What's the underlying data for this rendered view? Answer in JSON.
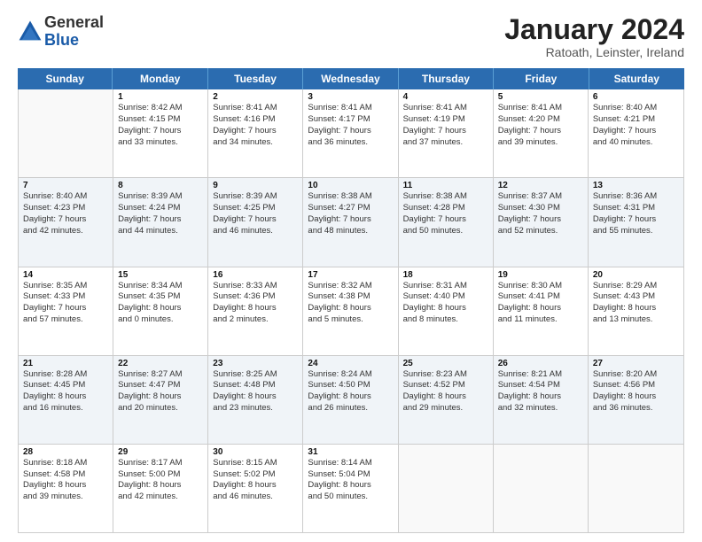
{
  "header": {
    "logo_general": "General",
    "logo_blue": "Blue",
    "month_title": "January 2024",
    "subtitle": "Ratoath, Leinster, Ireland"
  },
  "days_of_week": [
    "Sunday",
    "Monday",
    "Tuesday",
    "Wednesday",
    "Thursday",
    "Friday",
    "Saturday"
  ],
  "weeks": [
    {
      "alt": false,
      "cells": [
        {
          "day": "",
          "lines": []
        },
        {
          "day": "1",
          "lines": [
            "Sunrise: 8:42 AM",
            "Sunset: 4:15 PM",
            "Daylight: 7 hours",
            "and 33 minutes."
          ]
        },
        {
          "day": "2",
          "lines": [
            "Sunrise: 8:41 AM",
            "Sunset: 4:16 PM",
            "Daylight: 7 hours",
            "and 34 minutes."
          ]
        },
        {
          "day": "3",
          "lines": [
            "Sunrise: 8:41 AM",
            "Sunset: 4:17 PM",
            "Daylight: 7 hours",
            "and 36 minutes."
          ]
        },
        {
          "day": "4",
          "lines": [
            "Sunrise: 8:41 AM",
            "Sunset: 4:19 PM",
            "Daylight: 7 hours",
            "and 37 minutes."
          ]
        },
        {
          "day": "5",
          "lines": [
            "Sunrise: 8:41 AM",
            "Sunset: 4:20 PM",
            "Daylight: 7 hours",
            "and 39 minutes."
          ]
        },
        {
          "day": "6",
          "lines": [
            "Sunrise: 8:40 AM",
            "Sunset: 4:21 PM",
            "Daylight: 7 hours",
            "and 40 minutes."
          ]
        }
      ]
    },
    {
      "alt": true,
      "cells": [
        {
          "day": "7",
          "lines": [
            "Sunrise: 8:40 AM",
            "Sunset: 4:23 PM",
            "Daylight: 7 hours",
            "and 42 minutes."
          ]
        },
        {
          "day": "8",
          "lines": [
            "Sunrise: 8:39 AM",
            "Sunset: 4:24 PM",
            "Daylight: 7 hours",
            "and 44 minutes."
          ]
        },
        {
          "day": "9",
          "lines": [
            "Sunrise: 8:39 AM",
            "Sunset: 4:25 PM",
            "Daylight: 7 hours",
            "and 46 minutes."
          ]
        },
        {
          "day": "10",
          "lines": [
            "Sunrise: 8:38 AM",
            "Sunset: 4:27 PM",
            "Daylight: 7 hours",
            "and 48 minutes."
          ]
        },
        {
          "day": "11",
          "lines": [
            "Sunrise: 8:38 AM",
            "Sunset: 4:28 PM",
            "Daylight: 7 hours",
            "and 50 minutes."
          ]
        },
        {
          "day": "12",
          "lines": [
            "Sunrise: 8:37 AM",
            "Sunset: 4:30 PM",
            "Daylight: 7 hours",
            "and 52 minutes."
          ]
        },
        {
          "day": "13",
          "lines": [
            "Sunrise: 8:36 AM",
            "Sunset: 4:31 PM",
            "Daylight: 7 hours",
            "and 55 minutes."
          ]
        }
      ]
    },
    {
      "alt": false,
      "cells": [
        {
          "day": "14",
          "lines": [
            "Sunrise: 8:35 AM",
            "Sunset: 4:33 PM",
            "Daylight: 7 hours",
            "and 57 minutes."
          ]
        },
        {
          "day": "15",
          "lines": [
            "Sunrise: 8:34 AM",
            "Sunset: 4:35 PM",
            "Daylight: 8 hours",
            "and 0 minutes."
          ]
        },
        {
          "day": "16",
          "lines": [
            "Sunrise: 8:33 AM",
            "Sunset: 4:36 PM",
            "Daylight: 8 hours",
            "and 2 minutes."
          ]
        },
        {
          "day": "17",
          "lines": [
            "Sunrise: 8:32 AM",
            "Sunset: 4:38 PM",
            "Daylight: 8 hours",
            "and 5 minutes."
          ]
        },
        {
          "day": "18",
          "lines": [
            "Sunrise: 8:31 AM",
            "Sunset: 4:40 PM",
            "Daylight: 8 hours",
            "and 8 minutes."
          ]
        },
        {
          "day": "19",
          "lines": [
            "Sunrise: 8:30 AM",
            "Sunset: 4:41 PM",
            "Daylight: 8 hours",
            "and 11 minutes."
          ]
        },
        {
          "day": "20",
          "lines": [
            "Sunrise: 8:29 AM",
            "Sunset: 4:43 PM",
            "Daylight: 8 hours",
            "and 13 minutes."
          ]
        }
      ]
    },
    {
      "alt": true,
      "cells": [
        {
          "day": "21",
          "lines": [
            "Sunrise: 8:28 AM",
            "Sunset: 4:45 PM",
            "Daylight: 8 hours",
            "and 16 minutes."
          ]
        },
        {
          "day": "22",
          "lines": [
            "Sunrise: 8:27 AM",
            "Sunset: 4:47 PM",
            "Daylight: 8 hours",
            "and 20 minutes."
          ]
        },
        {
          "day": "23",
          "lines": [
            "Sunrise: 8:25 AM",
            "Sunset: 4:48 PM",
            "Daylight: 8 hours",
            "and 23 minutes."
          ]
        },
        {
          "day": "24",
          "lines": [
            "Sunrise: 8:24 AM",
            "Sunset: 4:50 PM",
            "Daylight: 8 hours",
            "and 26 minutes."
          ]
        },
        {
          "day": "25",
          "lines": [
            "Sunrise: 8:23 AM",
            "Sunset: 4:52 PM",
            "Daylight: 8 hours",
            "and 29 minutes."
          ]
        },
        {
          "day": "26",
          "lines": [
            "Sunrise: 8:21 AM",
            "Sunset: 4:54 PM",
            "Daylight: 8 hours",
            "and 32 minutes."
          ]
        },
        {
          "day": "27",
          "lines": [
            "Sunrise: 8:20 AM",
            "Sunset: 4:56 PM",
            "Daylight: 8 hours",
            "and 36 minutes."
          ]
        }
      ]
    },
    {
      "alt": false,
      "cells": [
        {
          "day": "28",
          "lines": [
            "Sunrise: 8:18 AM",
            "Sunset: 4:58 PM",
            "Daylight: 8 hours",
            "and 39 minutes."
          ]
        },
        {
          "day": "29",
          "lines": [
            "Sunrise: 8:17 AM",
            "Sunset: 5:00 PM",
            "Daylight: 8 hours",
            "and 42 minutes."
          ]
        },
        {
          "day": "30",
          "lines": [
            "Sunrise: 8:15 AM",
            "Sunset: 5:02 PM",
            "Daylight: 8 hours",
            "and 46 minutes."
          ]
        },
        {
          "day": "31",
          "lines": [
            "Sunrise: 8:14 AM",
            "Sunset: 5:04 PM",
            "Daylight: 8 hours",
            "and 50 minutes."
          ]
        },
        {
          "day": "",
          "lines": []
        },
        {
          "day": "",
          "lines": []
        },
        {
          "day": "",
          "lines": []
        }
      ]
    }
  ]
}
